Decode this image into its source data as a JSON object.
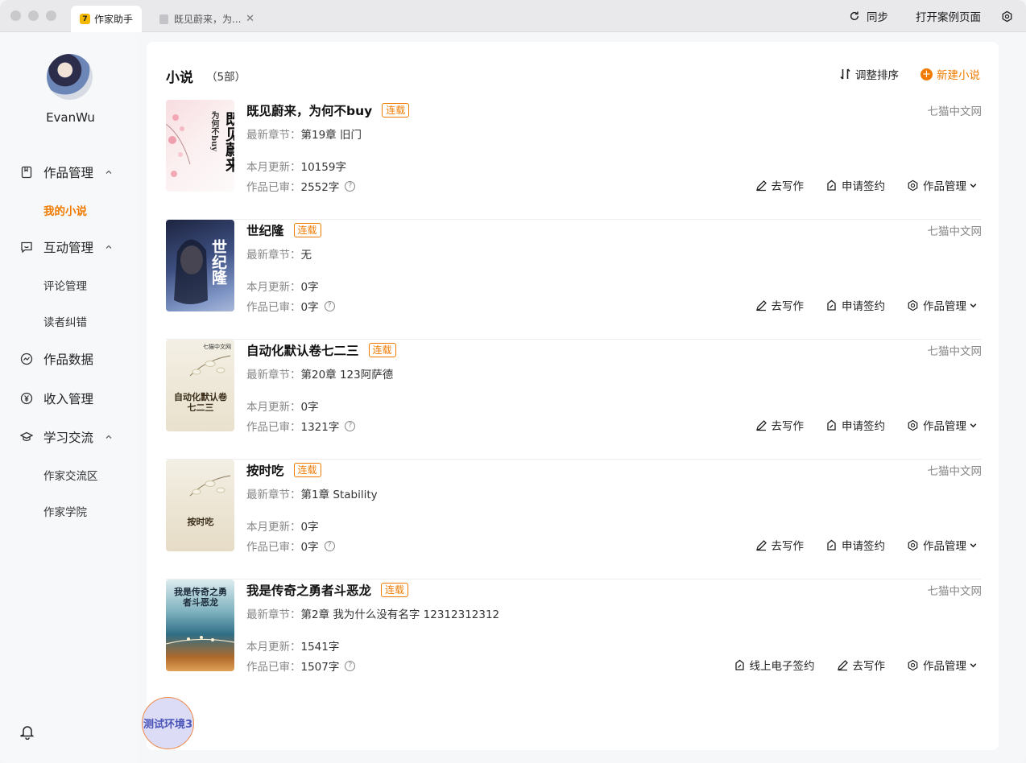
{
  "titlebar": {
    "tabs": [
      {
        "label": "作家助手"
      },
      {
        "label": "既见蔚来，为..."
      }
    ],
    "sync_label": "同步",
    "open_case_label": "打开案例页面"
  },
  "sidebar": {
    "username": "EvanWu",
    "nav": [
      {
        "label": "作品管理",
        "icon": "book-icon",
        "children": [
          {
            "label": "我的小说",
            "active": true
          }
        ]
      },
      {
        "label": "互动管理",
        "icon": "message-icon",
        "children": [
          {
            "label": "评论管理"
          },
          {
            "label": "读者纠错"
          }
        ]
      },
      {
        "label": "作品数据",
        "icon": "chart-icon"
      },
      {
        "label": "收入管理",
        "icon": "yuan-icon"
      },
      {
        "label": "学习交流",
        "icon": "graduation-cap-icon",
        "children": [
          {
            "label": "作家交流区"
          },
          {
            "label": "作家学院"
          }
        ]
      }
    ]
  },
  "main": {
    "title": "小说",
    "count": "（5部）",
    "sort_label": "调整排序",
    "new_label": "新建小说",
    "labels": {
      "latest": "最新章节：",
      "month": "本月更新：",
      "reviewed": "作品已审："
    },
    "books": [
      {
        "title": "既见蔚来，为何不buy",
        "status": "连载",
        "platform": "七猫中文网",
        "latest_chapter": "第19章 旧门",
        "month_update": "10159字",
        "reviewed": "2552字",
        "cover_text": "既见蔚来",
        "cover_sub": "为何不buy",
        "actions": [
          "去写作",
          "申请签约",
          "作品管理"
        ]
      },
      {
        "title": "世纪隆",
        "status": "连载",
        "platform": "七猫中文网",
        "latest_chapter": "无",
        "month_update": "0字",
        "reviewed": "0字",
        "cover_text": "世纪隆",
        "actions": [
          "去写作",
          "申请签约",
          "作品管理"
        ]
      },
      {
        "title": "自动化默认卷七二三",
        "status": "连载",
        "platform": "七猫中文网",
        "latest_chapter": "第20章 123阿萨德",
        "month_update": "0字",
        "reviewed": "1321字",
        "cover_text": "自动化默认卷七二三",
        "cover_brand": "七猫中文网",
        "actions": [
          "去写作",
          "申请签约",
          "作品管理"
        ]
      },
      {
        "title": "按时吃",
        "status": "连载",
        "platform": "七猫中文网",
        "latest_chapter": "第1章 Stability",
        "month_update": "0字",
        "reviewed": "0字",
        "cover_text": "按时吃",
        "actions": [
          "去写作",
          "申请签约",
          "作品管理"
        ]
      },
      {
        "title": "我是传奇之勇者斗恶龙",
        "status": "连载",
        "platform": "七猫中文网",
        "latest_chapter": "第2章 我为什么没有名字 12312312312",
        "month_update": "1541字",
        "reviewed": "1507字",
        "cover_text": "我是传奇之勇者斗恶龙",
        "actions": [
          "线上电子签约",
          "去写作",
          "作品管理"
        ]
      }
    ]
  },
  "float_button": "测试环境3",
  "colors": {
    "accent": "#f07b00",
    "float_bg": "#dcdcf6",
    "float_text": "#4b55b8"
  }
}
